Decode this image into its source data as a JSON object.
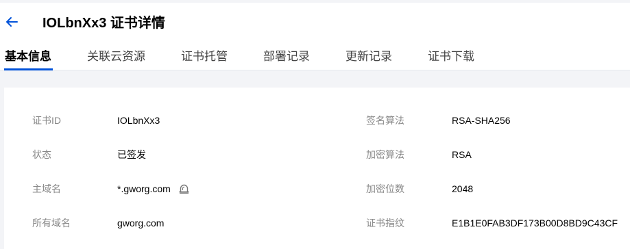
{
  "header": {
    "title": "IOLbnXx3 证书详情"
  },
  "tabs": [
    {
      "label": "基本信息",
      "active": true
    },
    {
      "label": "关联云资源",
      "active": false
    },
    {
      "label": "证书托管",
      "active": false
    },
    {
      "label": "部署记录",
      "active": false
    },
    {
      "label": "更新记录",
      "active": false
    },
    {
      "label": "证书下载",
      "active": false
    }
  ],
  "details": {
    "left": [
      {
        "label": "证书ID",
        "value": "IOLbnXx3"
      },
      {
        "label": "状态",
        "value": "已签发"
      },
      {
        "label": "主域名",
        "value": "*.gworg.com"
      },
      {
        "label": "所有域名",
        "value": "gworg.com"
      }
    ],
    "right": [
      {
        "label": "签名算法",
        "value": "RSA-SHA256"
      },
      {
        "label": "加密算法",
        "value": "RSA"
      },
      {
        "label": "加密位数",
        "value": "2048"
      },
      {
        "label": "证书指纹",
        "value": "E1B1E0FAB3DF173B00D8BD9C43CF"
      }
    ]
  },
  "icons": {
    "back": "arrow-left-icon",
    "domain": "alert-bell-icon"
  },
  "colors": {
    "accent": "#0052d9",
    "page_background": "#f3f4f7",
    "label_text": "#888888",
    "value_text": "#000000"
  }
}
